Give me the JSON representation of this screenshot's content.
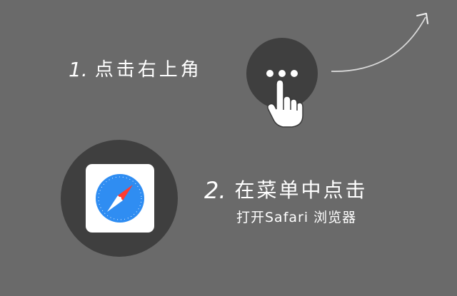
{
  "step1": {
    "number": "1.",
    "text": "点击右上角"
  },
  "step2": {
    "number": "2.",
    "text": "在菜单中点击",
    "subtext": "打开Safari 浏览器"
  },
  "icons": {
    "more_button": "more-options-icon",
    "pointer": "hand-pointer-icon",
    "arrow": "curved-arrow-icon",
    "safari": "safari-compass-icon"
  },
  "colors": {
    "background": "#6a6a6a",
    "circle": "#3f3f3f",
    "text": "#ffffff",
    "compass_blue": "#2f8df2",
    "needle_red": "#ff3b30"
  }
}
